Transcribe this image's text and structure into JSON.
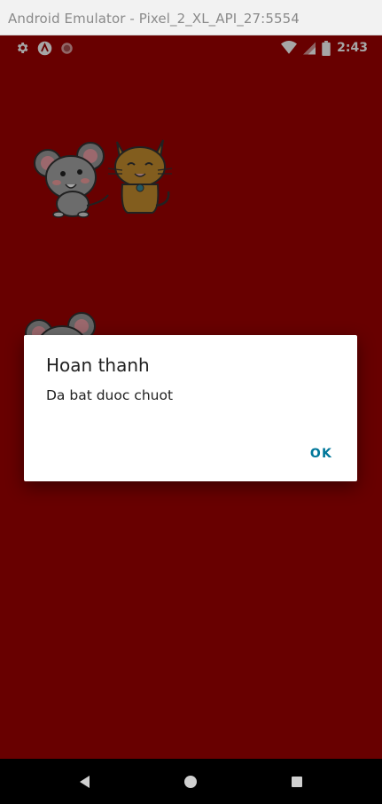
{
  "window": {
    "title": "Android Emulator - Pixel_2_XL_API_27:5554"
  },
  "status_bar": {
    "time": "2:43",
    "left_icons": [
      "gear-icon",
      "app-a-icon",
      "record-dot-icon"
    ],
    "right_icons": [
      "wifi-icon",
      "signal-icon",
      "battery-icon"
    ]
  },
  "app": {
    "background_color": "#a00000",
    "sprites": [
      "mouse",
      "cat",
      "mouse"
    ]
  },
  "dialog": {
    "title": "Hoan thanh",
    "message": "Da bat duoc chuot",
    "ok_label": "OK",
    "ok_color": "#00779a"
  },
  "nav_bar": {
    "buttons": [
      "back-icon",
      "home-icon",
      "recents-icon"
    ]
  }
}
